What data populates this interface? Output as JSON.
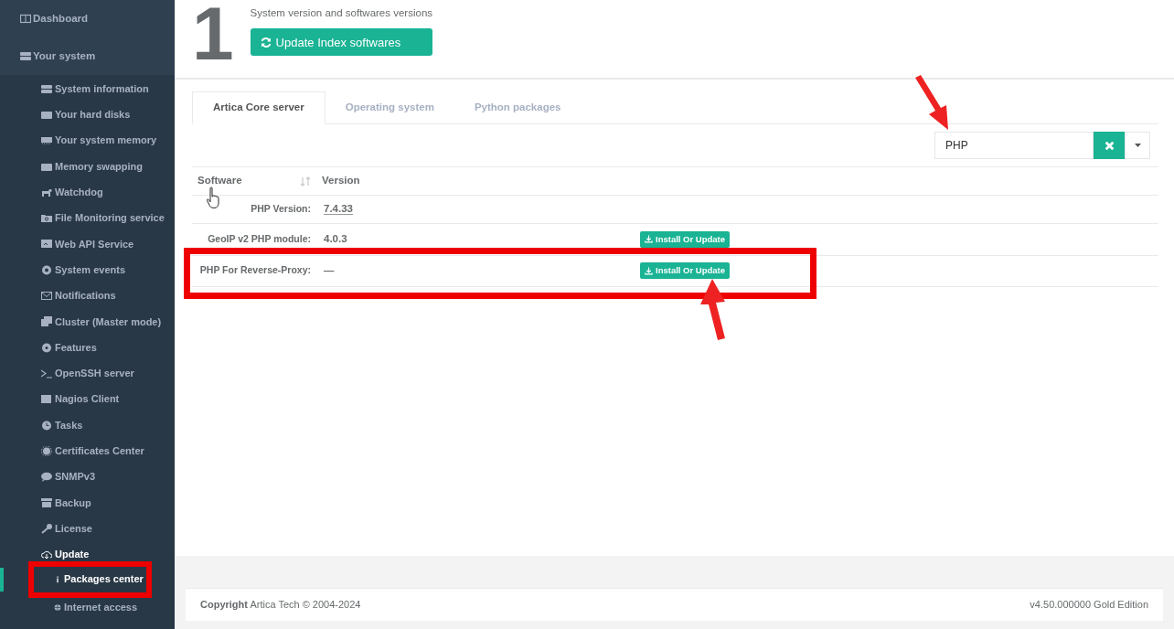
{
  "sidebar": {
    "items": [
      {
        "label": "Dashboard",
        "selected": false
      },
      {
        "label": "Your system",
        "selected": false,
        "children": [
          {
            "label": "System information",
            "selected": false,
            "expanded": false
          },
          {
            "label": "Your hard disks",
            "selected": false,
            "expanded": false
          },
          {
            "label": "Your system memory",
            "selected": false,
            "expanded": false
          },
          {
            "label": "Memory swapping",
            "selected": false,
            "expanded": false
          },
          {
            "label": "Watchdog",
            "selected": false,
            "expanded": false
          },
          {
            "label": "File Monitoring service",
            "selected": false,
            "expanded": false
          },
          {
            "label": "Web API Service",
            "selected": false,
            "expanded": false
          },
          {
            "label": "System events",
            "selected": false,
            "expanded": false
          },
          {
            "label": "Notifications",
            "selected": false,
            "expanded": false
          },
          {
            "label": "Cluster (Master mode)",
            "selected": false,
            "expanded": false
          },
          {
            "label": "Features",
            "selected": false,
            "expanded": false
          },
          {
            "label": "OpenSSH server",
            "selected": false,
            "expanded": false
          },
          {
            "label": "Nagios Client",
            "selected": false,
            "expanded": false
          },
          {
            "label": "Tasks",
            "selected": false,
            "expanded": false
          },
          {
            "label": "Certificates Center",
            "selected": false,
            "expanded": false
          },
          {
            "label": "SNMPv3",
            "selected": false,
            "expanded": false
          },
          {
            "label": "Backup",
            "selected": false,
            "expanded": false
          },
          {
            "label": "License",
            "selected": false,
            "expanded": false
          },
          {
            "label": "Update",
            "selected": false,
            "expanded": true,
            "children": [
              {
                "label": "Packages center",
                "selected": true
              },
              {
                "label": "Internet access",
                "selected": false
              }
            ]
          }
        ]
      }
    ]
  },
  "header": {
    "number": "1",
    "subtitle": "System version and softwares versions",
    "button": "Update Index softwares"
  },
  "tabs": [
    {
      "label": "Artica Core server",
      "selected": true
    },
    {
      "label": "Operating system",
      "selected": false
    },
    {
      "label": "Python packages",
      "selected": false
    }
  ],
  "search": {
    "value": "PHP"
  },
  "table": {
    "columns": [
      "Software",
      "Version"
    ],
    "rows": [
      {
        "software": "PHP Version:",
        "version": "7.4.33",
        "version_link": true
      },
      {
        "software": "GeoIP v2 PHP module:",
        "version": "4.0.3",
        "version_link": false,
        "action": "Install Or Update"
      },
      {
        "software": "PHP For Reverse-Proxy:",
        "version": "—",
        "version_link": false,
        "action": "Install Or Update"
      }
    ]
  },
  "footer": {
    "copyright": "**Copyright** Artica Tech © 2004-2024",
    "version": "v4.50.000000 Gold Edition"
  }
}
